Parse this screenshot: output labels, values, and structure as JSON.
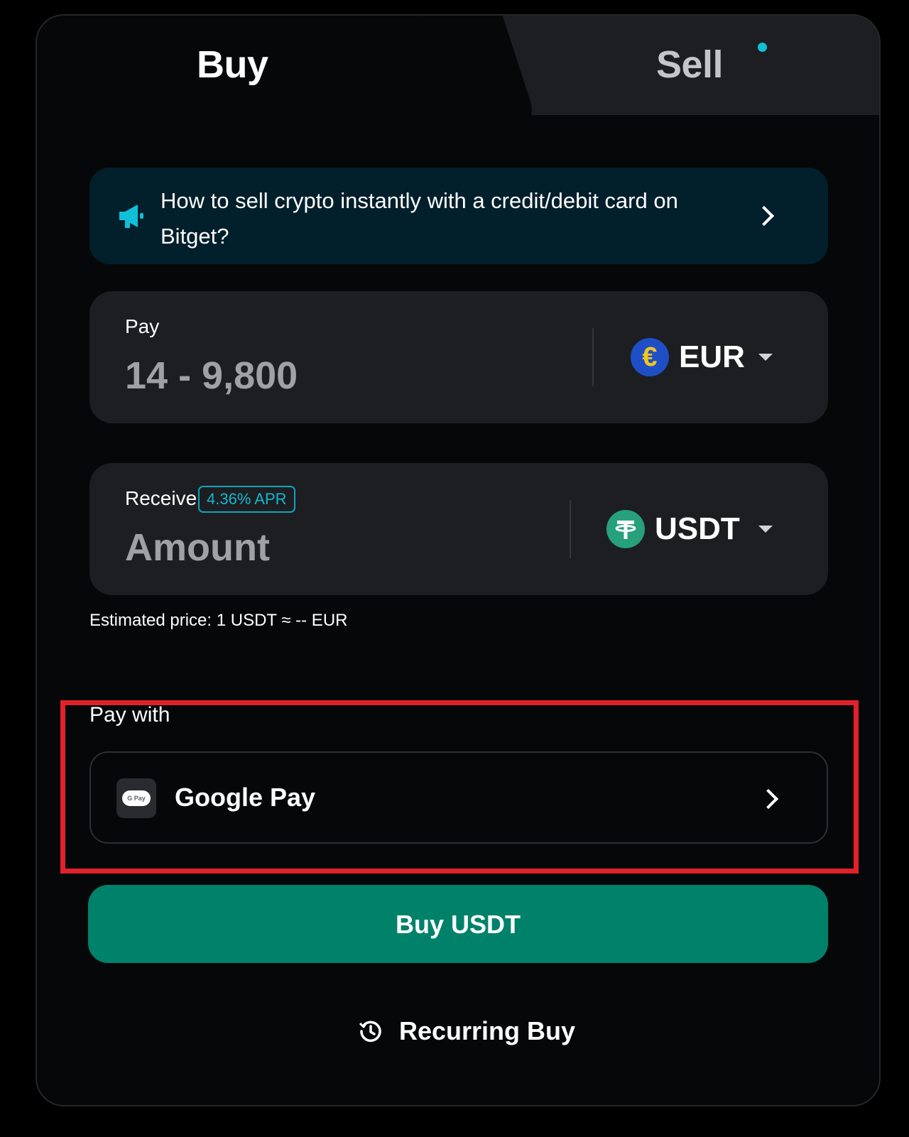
{
  "tabs": {
    "buy_label": "Buy",
    "sell_label": "Sell"
  },
  "banner": {
    "text": "How to sell crypto instantly with a credit/debit card on Bitget?",
    "icon": "megaphone-icon"
  },
  "pay": {
    "label": "Pay",
    "placeholder": "14 - 9,800",
    "currency": "EUR",
    "currency_symbol": "€"
  },
  "receive": {
    "label": "Receive",
    "apr_badge": "4.36% APR",
    "placeholder": "Amount",
    "currency": "USDT",
    "currency_symbol": "₮"
  },
  "estimated_price": "Estimated price: 1 USDT ≈ -- EUR",
  "pay_with": {
    "label": "Pay with",
    "method": "Google Pay",
    "method_icon_text": "G Pay"
  },
  "buy_button": "Buy USDT",
  "recurring_buy": "Recurring Buy",
  "colors": {
    "background": "#060708",
    "field": "#1d1e21",
    "accent_cyan": "#11c0d8",
    "primary_button": "#00826a",
    "highlight": "#e2212b"
  }
}
